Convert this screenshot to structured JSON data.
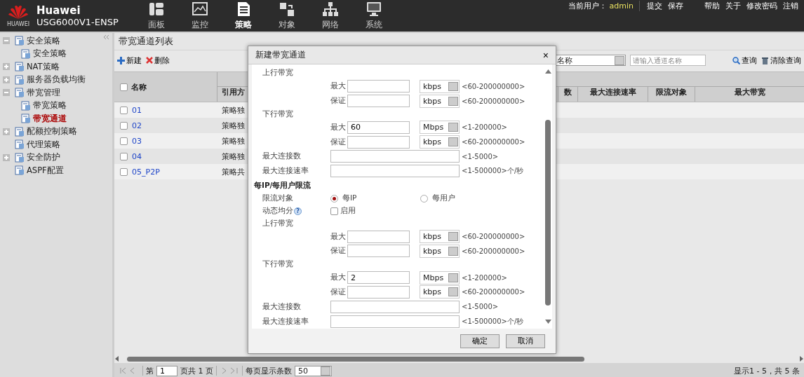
{
  "header": {
    "logo_text": "HUAWEI",
    "brand": "Huawei",
    "model": "USG6000V1-ENSP",
    "nav": [
      {
        "label": "面板",
        "kind": "dashboard",
        "selected": false
      },
      {
        "label": "监控",
        "kind": "monitor",
        "selected": false
      },
      {
        "label": "策略",
        "kind": "policy",
        "selected": true
      },
      {
        "label": "对象",
        "kind": "object",
        "selected": false
      },
      {
        "label": "网络",
        "kind": "network",
        "selected": false
      },
      {
        "label": "系统",
        "kind": "system",
        "selected": false
      }
    ],
    "user_label": "当前用户：",
    "user": "admin",
    "actions": [
      "提交",
      "保存"
    ],
    "links": [
      "帮助",
      "关于",
      "修改密码",
      "注销"
    ]
  },
  "sidebar": {
    "items": [
      {
        "label": "安全策略",
        "expanded": true,
        "selected": false,
        "children": [
          {
            "label": "安全策略",
            "selected": false
          }
        ]
      },
      {
        "label": "NAT策略",
        "expanded": false,
        "selected": false
      },
      {
        "label": "服务器负载均衡",
        "expanded": false,
        "selected": false
      },
      {
        "label": "带宽管理",
        "expanded": true,
        "selected": false,
        "children": [
          {
            "label": "带宽策略",
            "selected": false
          },
          {
            "label": "带宽通道",
            "selected": true
          }
        ]
      },
      {
        "label": "配额控制策略",
        "expanded": false,
        "selected": false
      },
      {
        "label": "代理策略",
        "selected": false
      },
      {
        "label": "安全防护",
        "expanded": false,
        "selected": false
      },
      {
        "label": "ASPF配置",
        "selected": false
      }
    ]
  },
  "panel": {
    "title": "带宽通道列表",
    "toolbar": [
      {
        "label": "新建",
        "kind": "add"
      },
      {
        "label": "删除",
        "kind": "delete"
      }
    ],
    "filter": {
      "field": "名称",
      "placeholder": "请输入通道名称",
      "buttons": [
        {
          "label": "查询",
          "kind": "search"
        },
        {
          "label": "清除查询",
          "kind": "clear"
        }
      ]
    },
    "table": {
      "select_all_checked": false,
      "columns": [
        "名称",
        "引用方"
      ],
      "right_columns": [
        "数",
        "最大连接速率",
        "限流对象",
        "最大带宽"
      ],
      "rows": [
        {
          "name": "01",
          "column_2": "策略独",
          "checked": false
        },
        {
          "name": "02",
          "column_2": "策略独",
          "checked": false
        },
        {
          "name": "03",
          "column_2": "策略独",
          "checked": false
        },
        {
          "name": "04",
          "column_2": "策略独",
          "checked": false
        },
        {
          "name": "05_P2P",
          "column_2": "策略共",
          "checked": false
        }
      ]
    },
    "pager": {
      "page_label": "第",
      "page": "1",
      "total": "页共 1 页",
      "size_label": "每页显示条数",
      "size": "50",
      "summary": "显示1 - 5，共 5 条"
    }
  },
  "dialog": {
    "title": "新建带宽通道",
    "close": "×",
    "fields": [
      {
        "kind": "group",
        "label": "上行带宽"
      },
      {
        "kind": "pair",
        "label": "最大",
        "unit": "kbps",
        "hint": "<60-200000000>"
      },
      {
        "kind": "pair",
        "label": "保证",
        "unit": "kbps",
        "hint": "<60-200000000>"
      },
      {
        "kind": "group",
        "label": "下行带宽"
      },
      {
        "kind": "pair",
        "label": "最大",
        "value": "60",
        "unit": "Mbps",
        "hint": "<1-200000>"
      },
      {
        "kind": "pair",
        "label": "保证",
        "unit": "kbps",
        "hint": "<60-200000000>"
      },
      {
        "kind": "wide",
        "label": "最大连接数",
        "hint": "<1-5000>"
      },
      {
        "kind": "wide",
        "label": "最大连接速率",
        "hint": "<1-500000>个/秒"
      },
      {
        "kind": "section",
        "label": "每IP/每用户限流"
      },
      {
        "kind": "radio",
        "label": "限流对象",
        "options": [
          {
            "label": "每IP",
            "selected": true
          },
          {
            "label": "每用户",
            "selected": false
          }
        ]
      },
      {
        "kind": "checkbox",
        "label": "动态均分",
        "help": "?",
        "option": "启用",
        "checked": false
      },
      {
        "kind": "group",
        "label": "上行带宽"
      },
      {
        "kind": "pair",
        "label": "最大",
        "unit": "kbps",
        "hint": "<60-200000000>"
      },
      {
        "kind": "pair",
        "label": "保证",
        "unit": "kbps",
        "hint": "<60-200000000>"
      },
      {
        "kind": "group",
        "label": "下行带宽"
      },
      {
        "kind": "pair",
        "label": "最大",
        "value": "2",
        "unit": "Mbps",
        "hint": "<1-200000>"
      },
      {
        "kind": "pair",
        "label": "保证",
        "unit": "kbps",
        "hint": "<60-200000000>"
      },
      {
        "kind": "wide",
        "label": "最大连接数",
        "hint": "<1-5000>"
      },
      {
        "kind": "wide",
        "label": "最大连接速率",
        "hint": "<1-500000>个/秒"
      }
    ],
    "buttons": [
      "确定",
      "取消"
    ]
  }
}
